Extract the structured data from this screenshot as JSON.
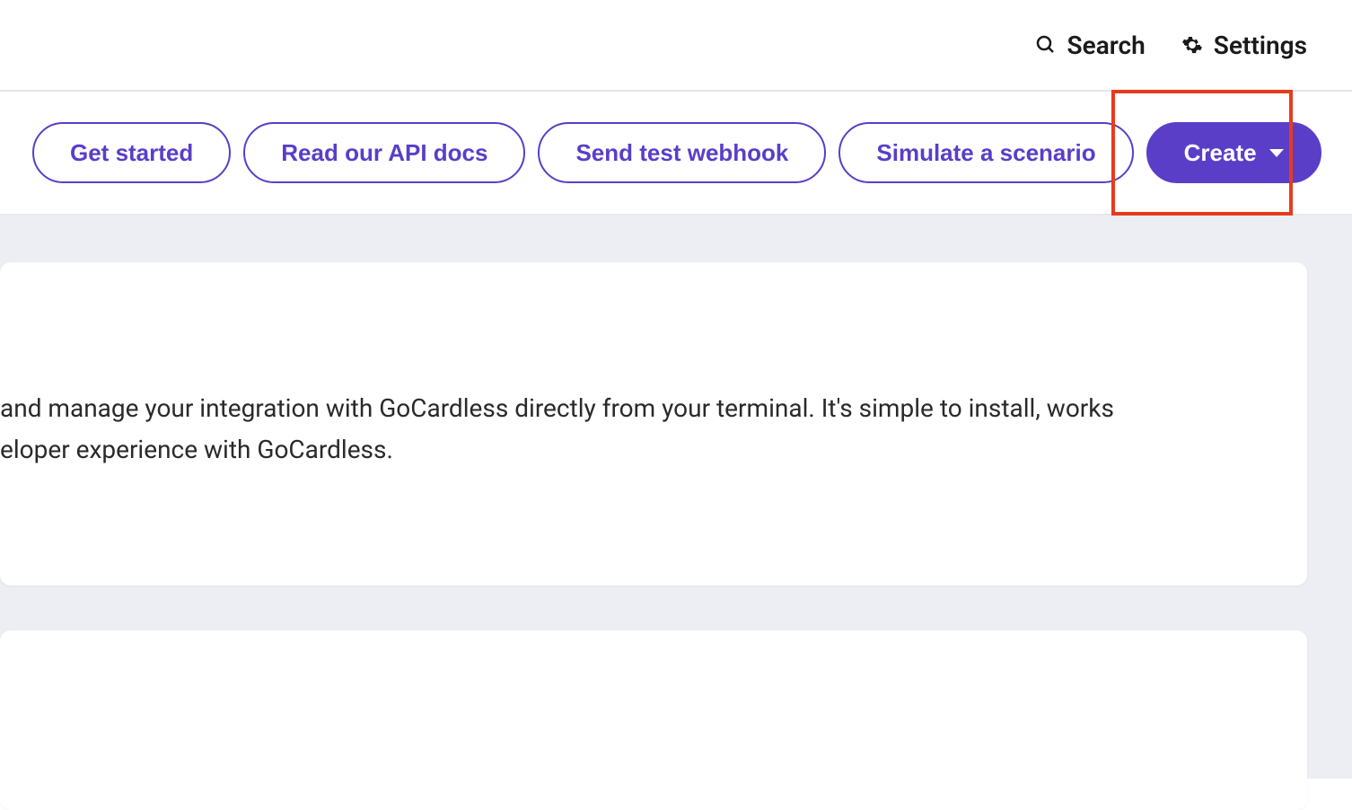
{
  "topbar": {
    "search_label": "Search",
    "settings_label": "Settings"
  },
  "actions": {
    "get_started": "Get started",
    "read_api_docs": "Read our API docs",
    "send_test_webhook": "Send test webhook",
    "simulate_scenario": "Simulate a scenario",
    "create": "Create"
  },
  "content": {
    "line1": " and manage your integration with GoCardless directly from your terminal. It's simple to install, works",
    "line2": "eloper experience with GoCardless."
  }
}
